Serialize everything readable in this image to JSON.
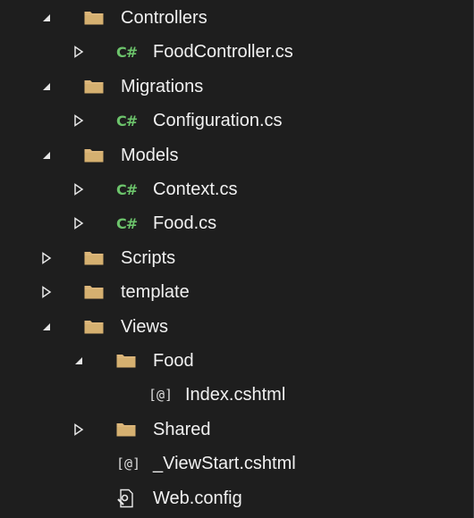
{
  "colors": {
    "background": "#1e1e1e",
    "text": "#f1f1f1",
    "folder": "#dcb67a",
    "csharp": "#6cc36b",
    "expander": "#e6e6e6"
  },
  "tree": [
    {
      "label": "Controllers",
      "kind": "folder",
      "expander": "expanded",
      "depth": 0
    },
    {
      "label": "FoodController.cs",
      "kind": "csharp",
      "icon_text": "C#",
      "expander": "collapsed",
      "depth": 1
    },
    {
      "label": "Migrations",
      "kind": "folder",
      "expander": "expanded",
      "depth": 0
    },
    {
      "label": "Configuration.cs",
      "kind": "csharp",
      "icon_text": "C#",
      "expander": "collapsed",
      "depth": 1
    },
    {
      "label": "Models",
      "kind": "folder",
      "expander": "expanded",
      "depth": 0
    },
    {
      "label": "Context.cs",
      "kind": "csharp",
      "icon_text": "C#",
      "expander": "collapsed",
      "depth": 1
    },
    {
      "label": "Food.cs",
      "kind": "csharp",
      "icon_text": "C#",
      "expander": "collapsed",
      "depth": 1
    },
    {
      "label": "Scripts",
      "kind": "folder",
      "expander": "collapsed",
      "depth": 0
    },
    {
      "label": "template",
      "kind": "folder",
      "expander": "collapsed",
      "depth": 0
    },
    {
      "label": "Views",
      "kind": "folder",
      "expander": "expanded",
      "depth": 0
    },
    {
      "label": "Food",
      "kind": "folder",
      "expander": "expanded",
      "depth": 1
    },
    {
      "label": "Index.cshtml",
      "kind": "razor",
      "icon_text": "[@]",
      "expander": "none",
      "depth": 2
    },
    {
      "label": "Shared",
      "kind": "folder",
      "expander": "collapsed",
      "depth": 1
    },
    {
      "label": "_ViewStart.cshtml",
      "kind": "razor",
      "icon_text": "[@]",
      "expander": "none",
      "depth": 1
    },
    {
      "label": "Web.config",
      "kind": "config",
      "expander": "none",
      "depth": 1
    }
  ]
}
